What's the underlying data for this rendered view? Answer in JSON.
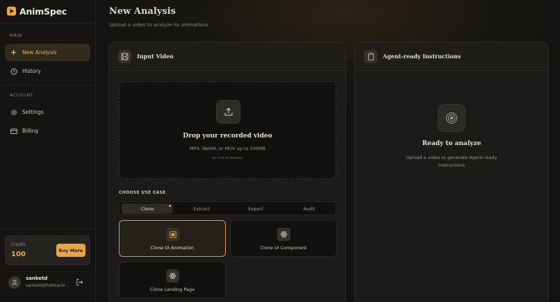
{
  "app": {
    "name": "AnimSpec"
  },
  "sidebar": {
    "sections": {
      "main": "MAIN",
      "account": "ACCOUNT"
    },
    "items": [
      {
        "label": "New Analysis",
        "icon": "plus-icon"
      },
      {
        "label": "History",
        "icon": "clock-icon"
      },
      {
        "label": "Settings",
        "icon": "gear-icon"
      },
      {
        "label": "Billing",
        "icon": "credit-card-icon"
      }
    ],
    "credits": {
      "label": "Credits",
      "value": "100",
      "button": "Buy More"
    },
    "user": {
      "name": "sanketd",
      "email": "sanketd@fullstackr..."
    }
  },
  "header": {
    "title": "New Analysis",
    "subtitle": "Upload a video to analyze its animations"
  },
  "input_panel": {
    "title": "Input Video",
    "dropzone": {
      "title": "Drop your recorded video",
      "formats": "MP4, WebM, or MOV up to 100MB",
      "browse": "or click to browse"
    },
    "use_case_label": "CHOOSE USE CASE",
    "tabs": [
      {
        "label": "Clone",
        "active": true
      },
      {
        "label": "Extract"
      },
      {
        "label": "Export"
      },
      {
        "label": "Audit"
      }
    ],
    "use_cases": [
      {
        "label": "Clone UI Animation",
        "selected": true
      },
      {
        "label": "Clone UI Component"
      },
      {
        "label": "Clone Landing Page"
      }
    ]
  },
  "output_panel": {
    "title": "Agent-ready Instructions",
    "ready_title": "Ready to analyze",
    "ready_desc": "Upload a video to generate Agent-ready Instructions"
  },
  "colors": {
    "accent": "#e9a545",
    "background": "#141311",
    "panel": "#1c1b19"
  }
}
